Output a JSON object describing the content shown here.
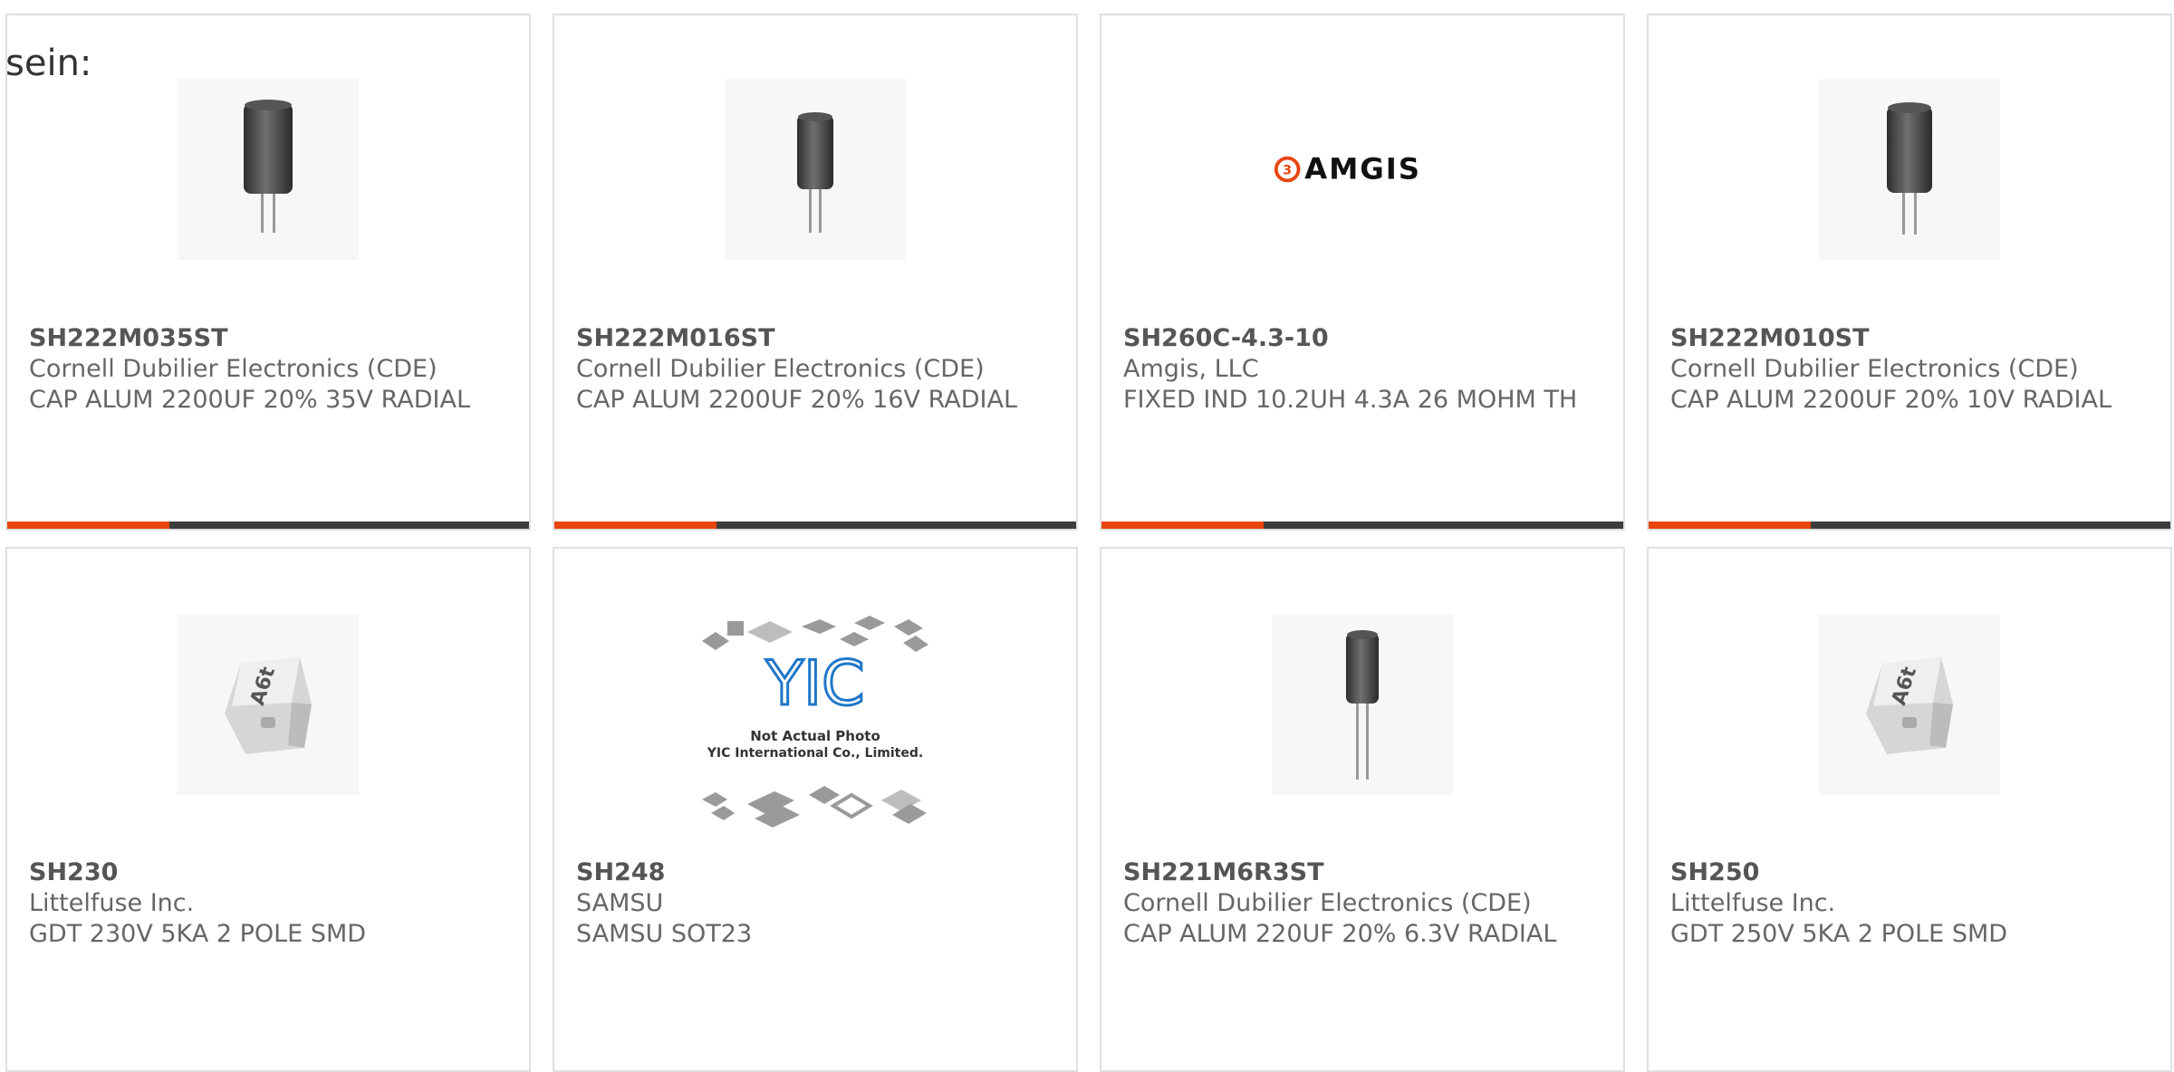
{
  "intro_text": "sein:",
  "colors": {
    "accent": "#e8450f",
    "bar_track": "#3d3d3d",
    "card_border": "#e0e0e0"
  },
  "products": [
    {
      "part": "SH222M035ST",
      "manufacturer": "Cornell Dubilier Electronics (CDE)",
      "description": "CAP ALUM 2200UF 20% 35V RADIAL",
      "image": "capacitor-icon",
      "bar_fill": 0.31
    },
    {
      "part": "SH222M016ST",
      "manufacturer": "Cornell Dubilier Electronics (CDE)",
      "description": "CAP ALUM 2200UF 20% 16V RADIAL",
      "image": "capacitor-icon",
      "bar_fill": 0.31
    },
    {
      "part": "SH260C-4.3-10",
      "manufacturer": "Amgis, LLC",
      "description": "FIXED IND 10.2UH 4.3A 26 MOHM TH",
      "image": "amgis-logo",
      "logo_text": "AMGIS",
      "bar_fill": 0.31
    },
    {
      "part": "SH222M010ST",
      "manufacturer": "Cornell Dubilier Electronics (CDE)",
      "description": "CAP ALUM 2200UF 20% 10V RADIAL",
      "image": "capacitor-icon",
      "bar_fill": 0.31
    },
    {
      "part": "SH230",
      "manufacturer": "Littelfuse Inc.",
      "description": "GDT 230V 5KA 2 POLE SMD",
      "image": "gas-discharge-tube-icon",
      "chip_text": "A6t"
    },
    {
      "part": "SH248",
      "manufacturer": "SAMSU",
      "description": "SAMSU SOT23",
      "image": "yic-placeholder",
      "photo_note_1": "Not Actual Photo",
      "photo_note_2": "YIC International Co., Limited.",
      "logo_text": "YIC"
    },
    {
      "part": "SH221M6R3ST",
      "manufacturer": "Cornell Dubilier Electronics (CDE)",
      "description": "CAP ALUM 220UF 20% 6.3V RADIAL",
      "image": "capacitor-icon"
    },
    {
      "part": "SH250",
      "manufacturer": "Littelfuse Inc.",
      "description": "GDT 250V 5KA 2 POLE SMD",
      "image": "gas-discharge-tube-icon",
      "chip_text": "A6t"
    }
  ]
}
